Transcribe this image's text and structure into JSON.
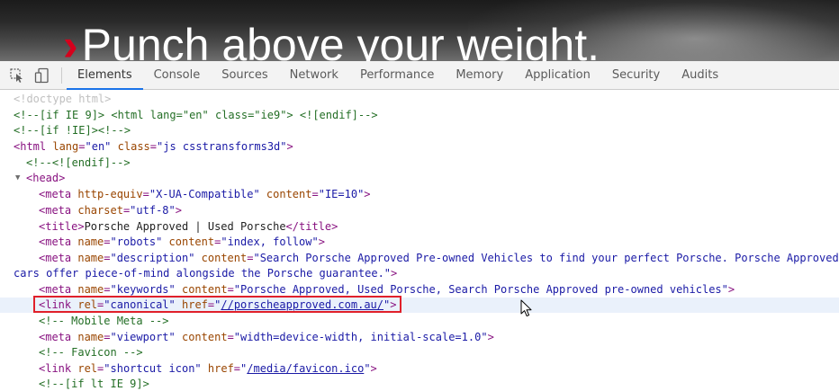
{
  "banner": {
    "chevron": "›",
    "headline": "Punch above your weight."
  },
  "toolbar": {
    "icons": [
      "inspect-element-icon",
      "device-toggle-icon"
    ],
    "tabs": [
      "Elements",
      "Console",
      "Sources",
      "Network",
      "Performance",
      "Memory",
      "Application",
      "Security",
      "Audits"
    ],
    "active_tab": "Elements"
  },
  "dom": {
    "doctype": "<!doctype html>",
    "l2": "<!--[if IE 9]> <html lang=\"en\" class=\"ie9\"> <![endif]-->",
    "l3": "<!--[if !IE]><!-->",
    "html_open": "<html",
    "html_lang_name": "lang",
    "html_lang_value": "\"en\"",
    "html_class_name": "class",
    "html_class_value": "\"js csstransforms3d\"",
    "l5": "<!--<![endif]-->",
    "head_open": "<head>",
    "meta1_name1": "http-equiv",
    "meta1_val1": "\"X-UA-Compatible\"",
    "meta1_name2": "content",
    "meta1_val2": "\"IE=10\"",
    "meta2_name": "charset",
    "meta2_val": "\"utf-8\"",
    "title_open": "<title>",
    "title_text": "Porsche Approved | Used Porsche",
    "title_close": "</title>",
    "meta3_name1": "name",
    "meta3_val1": "\"robots\"",
    "meta3_name2": "content",
    "meta3_val2": "\"index, follow\"",
    "meta4_name1": "name",
    "meta4_val1": "\"description\"",
    "meta4_name2": "content",
    "meta4_val2a": "\"Search Porsche Approved Pre-owned Vehicles to find your perfect Porsche. Porsche Approved",
    "meta4_val2b": "cars offer piece-of-mind alongside the Porsche guarantee.\"",
    "meta5_name1": "name",
    "meta5_val1": "\"keywords\"",
    "meta5_name2": "content",
    "meta5_val2": "\"Porsche Approved, Used Porsche, Search Porsche Approved pre-owned vehicles\"",
    "link1_rel_name": "rel",
    "link1_rel_val": "\"canonical\"",
    "link1_href_name": "href",
    "link1_href_url": "//porscheapproved.com.au/",
    "comment_mobile": "<!-- Mobile Meta -->",
    "meta6_name1": "name",
    "meta6_val1": "\"viewport\"",
    "meta6_name2": "content",
    "meta6_val2": "\"width=device-width, initial-scale=1.0\"",
    "comment_favicon": "<!-- Favicon -->",
    "link2_rel_name": "rel",
    "link2_rel_val": "\"shortcut icon\"",
    "link2_href_name": "href",
    "link2_href_url": "/media/favicon.ico",
    "last_line": "<!--[if lt IE 9]>"
  },
  "colors": {
    "tag": "#881280",
    "attr_name": "#994500",
    "attr_value": "#1a1aa6",
    "comment": "#236e25",
    "selection_box": "#e0202a",
    "active_tab_underline": "#1a73e8",
    "brand_red": "#d5001c"
  }
}
